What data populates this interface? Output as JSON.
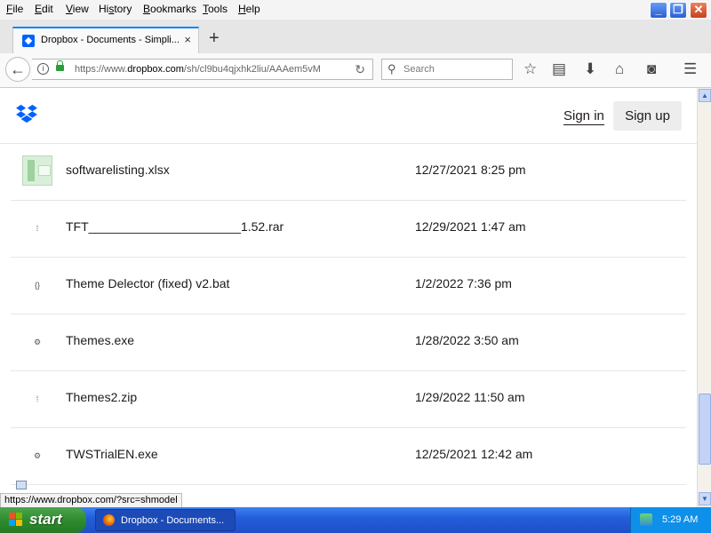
{
  "menu": {
    "items": [
      {
        "key": "F",
        "rest": "ile"
      },
      {
        "key": "E",
        "rest": "dit"
      },
      {
        "key": "V",
        "rest": "iew"
      },
      {
        "key": "",
        "rest": "Hi",
        "key2": "s",
        "rest2": "tory"
      },
      {
        "key": "B",
        "rest": "ookmarks"
      },
      {
        "key": "T",
        "rest": "ools"
      },
      {
        "key": "H",
        "rest": "elp"
      }
    ]
  },
  "window": {
    "minimize": "_",
    "restore": "❐",
    "close": "✕"
  },
  "tab": {
    "title": "Dropbox - Documents - Simpli...",
    "close": "×",
    "new_tab": "+"
  },
  "nav": {
    "back": "←",
    "url_prefix": "https://www.",
    "url_domain": "dropbox.com",
    "url_path": "/sh/cl9bu4qjxhk2liu/AAAem5vM",
    "reload": "↻",
    "search_placeholder": "Search"
  },
  "header": {
    "sign_in": "Sign in",
    "sign_up": "Sign up"
  },
  "files": [
    {
      "icon": "spreadsheet-thumbnail",
      "name": "softwarelisting.xlsx",
      "date": "12/27/2021 8:25 pm"
    },
    {
      "icon": "zip-icon",
      "glyph": "⁞",
      "name": "TFT______________________1.52.rar",
      "date": "12/29/2021 1:47 am"
    },
    {
      "icon": "code-icon",
      "glyph": "{}",
      "name": "Theme Delector (fixed) v2.bat",
      "date": "1/2/2022 7:36 pm"
    },
    {
      "icon": "gear-icon",
      "glyph": "⚙",
      "name": "Themes.exe",
      "date": "1/28/2022 3:50 am"
    },
    {
      "icon": "zip-icon",
      "glyph": "⁞",
      "name": "Themes2.zip",
      "date": "1/29/2022 11:50 am"
    },
    {
      "icon": "gear-icon",
      "glyph": "⚙",
      "name": "TWSTrialEN.exe",
      "date": "12/25/2021 12:42 am"
    }
  ],
  "status_url": "https://www.dropbox.com/?src=shmodel",
  "taskbar": {
    "start": "start",
    "item": "Dropbox - Documents...",
    "clock": "5:29 AM"
  },
  "colors": {
    "dropbox_blue": "#0061fe",
    "tab_accent": "#0a84ff",
    "taskbar_blue": "#245edb",
    "start_green": "#2e8b2e"
  }
}
